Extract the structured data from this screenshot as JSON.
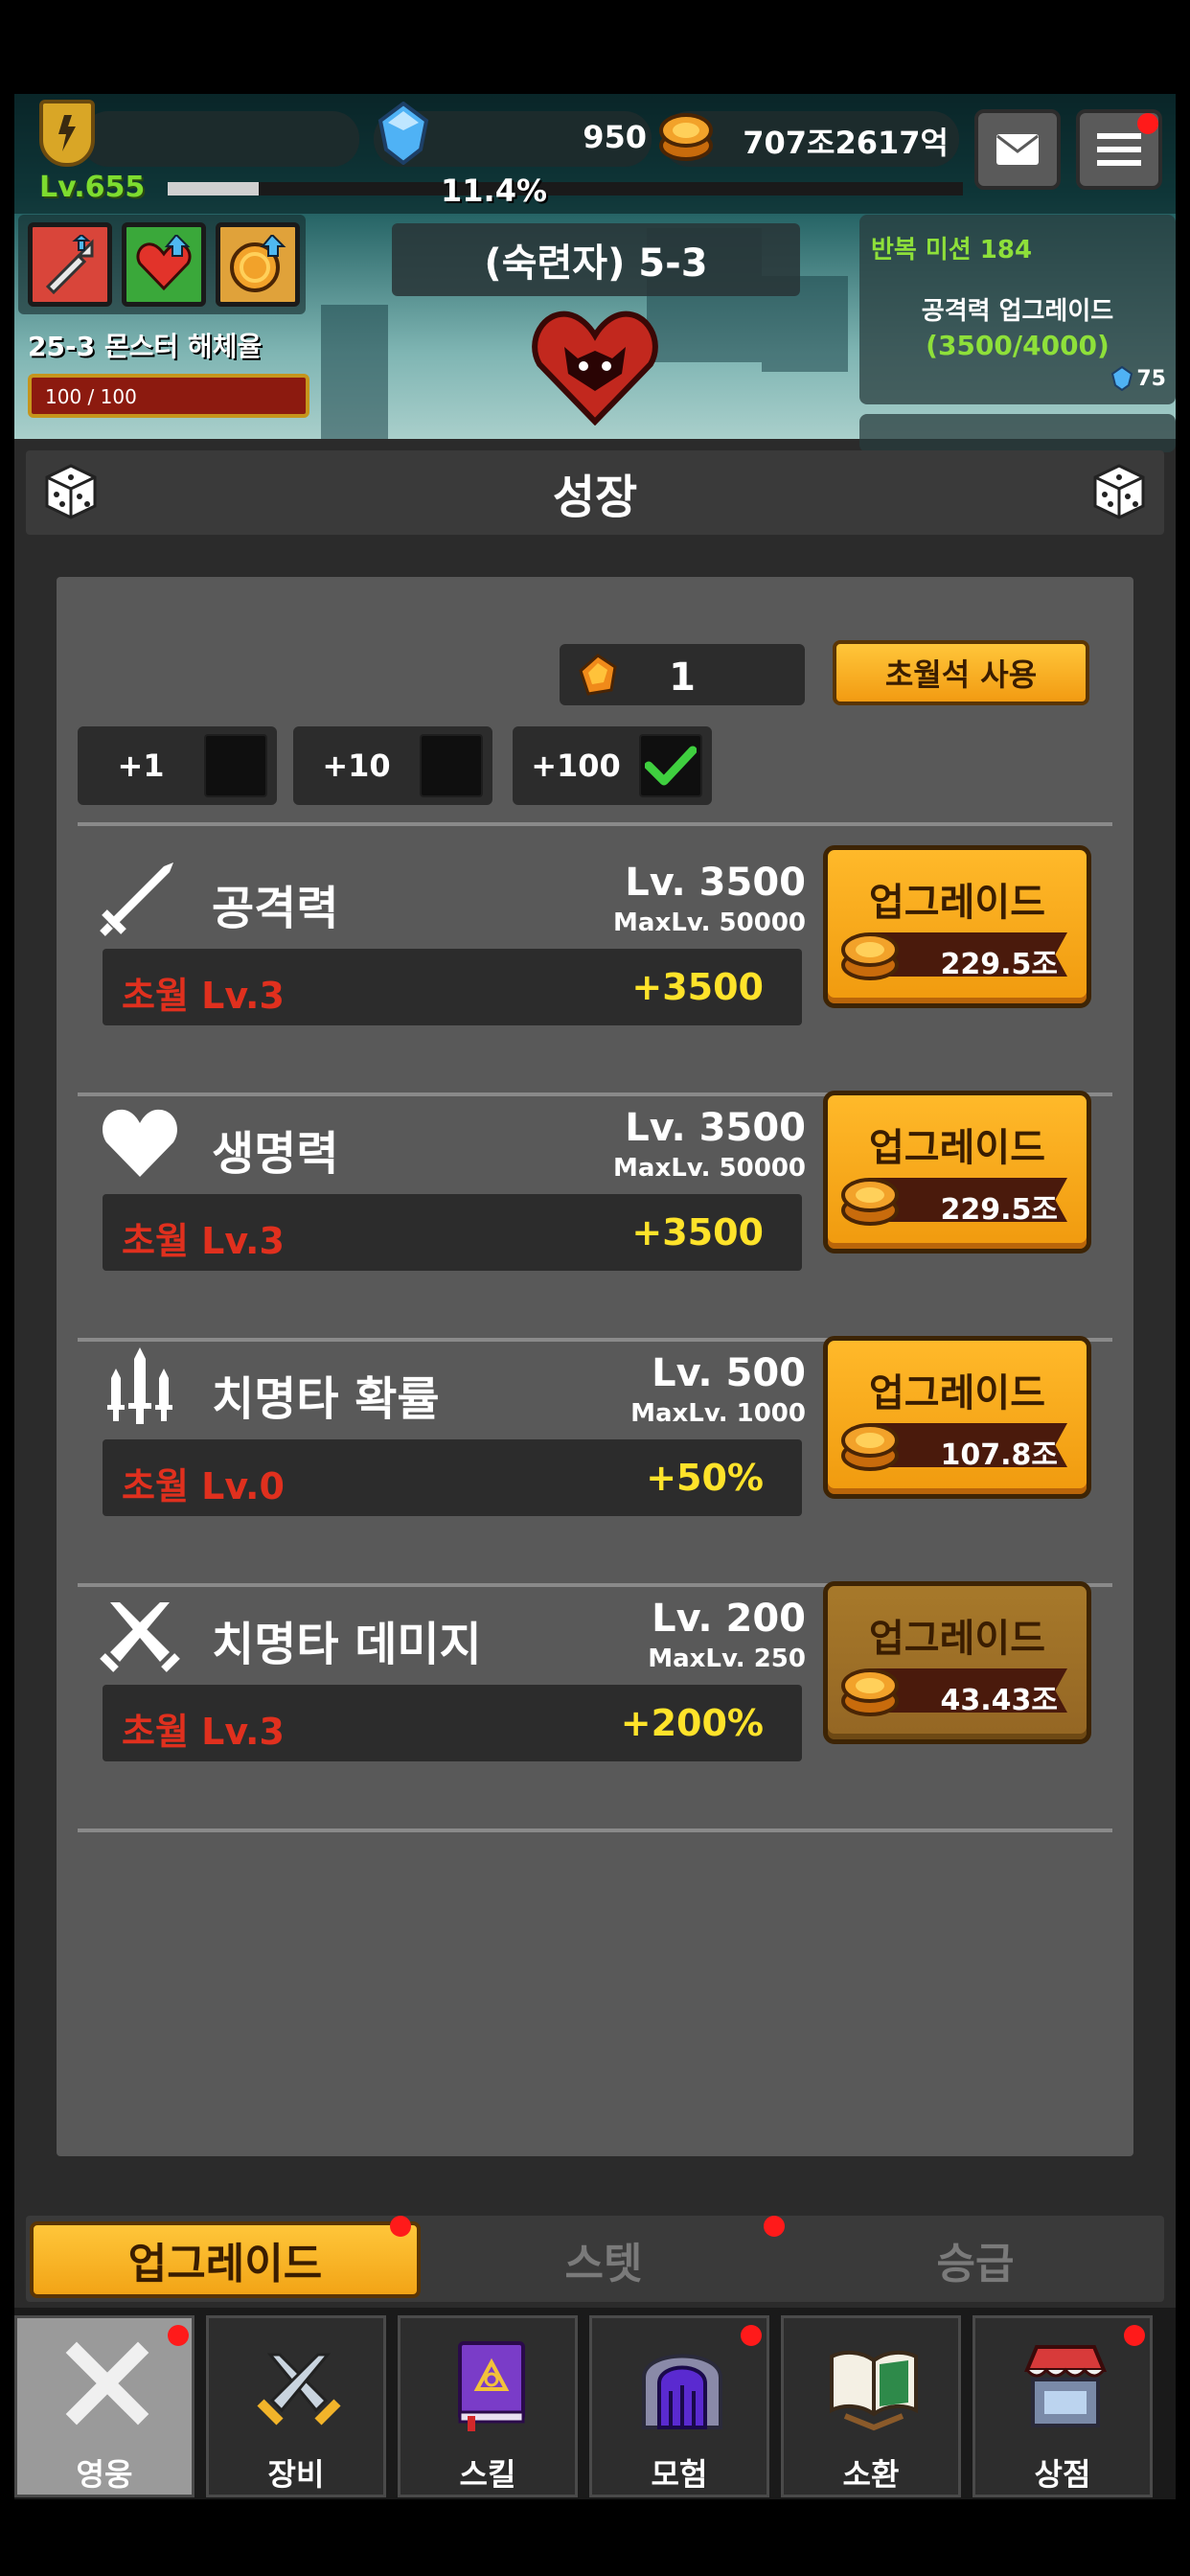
{
  "hud": {
    "level": "Lv.655",
    "gems": "950",
    "gold": "707조2617억",
    "xp_percent": "11.4%",
    "xp_fraction": 0.114,
    "icons": {
      "rank": "rank-shield-icon",
      "gem": "gem-icon",
      "gold": "gold-coin-icon",
      "mail": "mail-icon",
      "menu": "menu-icon"
    },
    "buffs": [
      "attack-up-buff-icon",
      "health-up-buff-icon",
      "gold-up-buff-icon"
    ],
    "monster_label": "25-3 몬스터 해체율",
    "hp_text": "100 / 100",
    "hp_fraction": 1.0,
    "stage": "(숙련자) 5-3",
    "boss_icon": "demon-boss-icon",
    "mission": {
      "title": "반복 미션 184",
      "name": "공격력 업그레이드",
      "progress": "(3500/4000)",
      "reward": "75"
    }
  },
  "panel": {
    "title": "성장",
    "dice_icon": "dice-icon",
    "stone_count": "1",
    "use_button": "초월석 사용",
    "multipliers": [
      {
        "label": "+1",
        "checked": false
      },
      {
        "label": "+10",
        "checked": false
      },
      {
        "label": "+100",
        "checked": true
      }
    ]
  },
  "stats": [
    {
      "icon": "sword-icon",
      "name": "공격력",
      "level": "Lv. 3500",
      "max": "MaxLv. 50000",
      "trans": "초월 Lv.3",
      "bonus": "+3500",
      "button": "업그레이드",
      "cost": "229.5조",
      "enabled": true
    },
    {
      "icon": "heart-icon",
      "name": "생명력",
      "level": "Lv. 3500",
      "max": "MaxLv. 50000",
      "trans": "초월 Lv.3",
      "bonus": "+3500",
      "button": "업그레이드",
      "cost": "229.5조",
      "enabled": true
    },
    {
      "icon": "triple-dagger-icon",
      "name": "치명타 확률",
      "level": "Lv. 500",
      "max": "MaxLv. 1000",
      "trans": "초월 Lv.0",
      "bonus": "+50%",
      "button": "업그레이드",
      "cost": "107.8조",
      "enabled": true
    },
    {
      "icon": "crossed-swords-icon",
      "name": "치명타 데미지",
      "level": "Lv. 200",
      "max": "MaxLv. 250",
      "trans": "초월 Lv.3",
      "bonus": "+200%",
      "button": "업그레이드",
      "cost": "43.43조",
      "enabled": false
    }
  ],
  "tabs": [
    {
      "label": "업그레이드",
      "active": true
    },
    {
      "label": "스텟",
      "active": false
    },
    {
      "label": "승급",
      "active": false
    }
  ],
  "nav": [
    {
      "label": "영웅",
      "icon": "close-icon",
      "active": true
    },
    {
      "label": "장비",
      "icon": "equipment-icon",
      "active": false
    },
    {
      "label": "스킬",
      "icon": "skill-book-icon",
      "active": false
    },
    {
      "label": "모험",
      "icon": "dungeon-gate-icon",
      "active": false
    },
    {
      "label": "소환",
      "icon": "summon-book-icon",
      "active": false
    },
    {
      "label": "상점",
      "icon": "shop-icon",
      "active": false
    }
  ],
  "colors": {
    "accent_gold": "#f29b12",
    "level_green": "#7ddc2f",
    "transcend_red": "#e0301e",
    "bonus_yellow": "#ffe32a",
    "notify_red": "#ff1a1a"
  }
}
